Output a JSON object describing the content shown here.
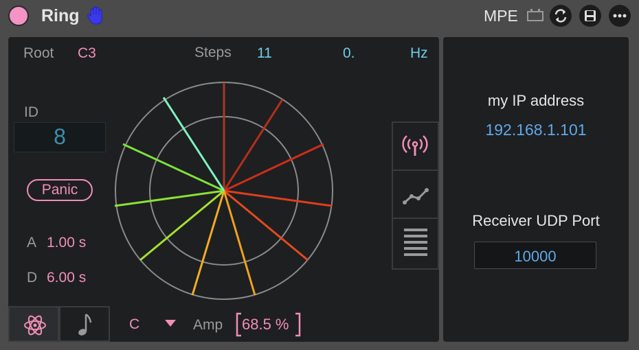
{
  "device": {
    "title": "Ring",
    "mpe_label": "MPE"
  },
  "params": {
    "root_label": "Root",
    "root_value": "C3",
    "steps_label": "Steps",
    "steps_value": "11",
    "freq_value": "0.",
    "freq_unit": "Hz",
    "id_label": "ID",
    "id_value": "8",
    "panic_label": "Panic",
    "attack_label": "A",
    "attack_value": "1.00 s",
    "decay_label": "D",
    "decay_value": "6.00 s",
    "key_value": "C",
    "amp_label": "Amp",
    "amp_value": "68.5 %"
  },
  "network": {
    "ip_label": "my IP address",
    "ip_value": "192.168.1.101",
    "port_label": "Receiver UDP Port",
    "port_value": "10000"
  },
  "icons": {
    "power": "power-toggle",
    "hand": "hand-icon",
    "mpe": "mpe-icon",
    "refresh": "refresh-icon",
    "save": "save-icon",
    "more": "more-icon",
    "antenna": "antenna-icon",
    "graph": "graph-icon",
    "lines": "lines-icon",
    "atom": "atom-icon",
    "note": "note-icon"
  },
  "colors": {
    "accent_pink": "#f18fb6",
    "accent_cyan": "#6ecde6",
    "ip_blue": "#5fa9e8"
  }
}
